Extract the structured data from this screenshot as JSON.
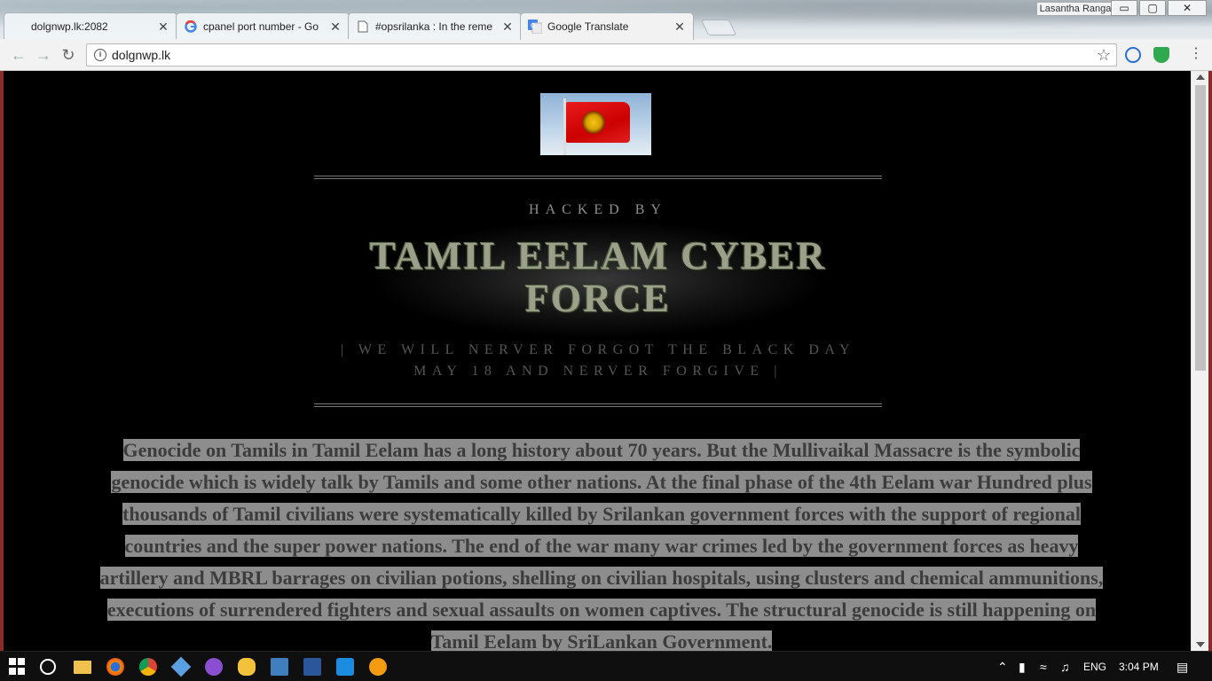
{
  "browser": {
    "profile_name": "Lasantha Ranga",
    "window_buttons": {
      "minimize": "▭",
      "maximize": "▢",
      "close": "✕"
    },
    "tabs": [
      {
        "title": "dolgnwp.lk:2082",
        "icon": "blank-page-icon",
        "active": false
      },
      {
        "title": "cpanel port number - Go",
        "icon": "google-icon",
        "active": false
      },
      {
        "title": "#opsrilanka : In the reme",
        "icon": "document-icon",
        "active": false
      },
      {
        "title": "Google Translate",
        "icon": "google-translate-icon",
        "active": true
      }
    ],
    "address": "dolgnwp.lk",
    "tab_close_glyph": "✕"
  },
  "page": {
    "hacked_by": "HACKED BY",
    "title": "TAMIL EELAM CYBER FORCE",
    "tagline_line1": "| WE WILL NERVER FORGOT THE BLACK DAY",
    "tagline_line2": "MAY 18 AND NERVER FORGIVE |",
    "paragraph_lines": [
      "Genocide on Tamils in Tamil Eelam has a long history about 70 years. But the Mullivaikal Massacre is the symbolic",
      "genocide which is widely talk by Tamils and some other nations. At the final phase of the 4th Eelam war Hundred plus",
      "thousands of Tamil civilians were systematically killed by Srilankan government forces with the support of regional",
      "countries and the super power nations. The end of the war many war crimes led by the government forces as heavy",
      "artillery and MBRL barrages on civilian potions, shelling on civilian hospitals, using clusters and chemical ammunitions,",
      "executions of surrendered fighters and sexual assaults on women captives. The structural genocide is still happening on",
      "Tamil Eelam by SriLankan Government."
    ]
  },
  "taskbar": {
    "language": "ENG",
    "time": "3:04 PM",
    "pinned_icons": [
      "file-explorer-icon",
      "firefox-icon",
      "chrome-icon",
      "virtualbox-icon",
      "app-icon",
      "winscp-icon",
      "notepad-plus-icon",
      "word-icon",
      "teamviewer-icon",
      "settings-app-icon"
    ]
  },
  "colors": {
    "page_background": "#000000",
    "highlight": "#8d8d8d",
    "title_camo": "#9ca08a"
  }
}
